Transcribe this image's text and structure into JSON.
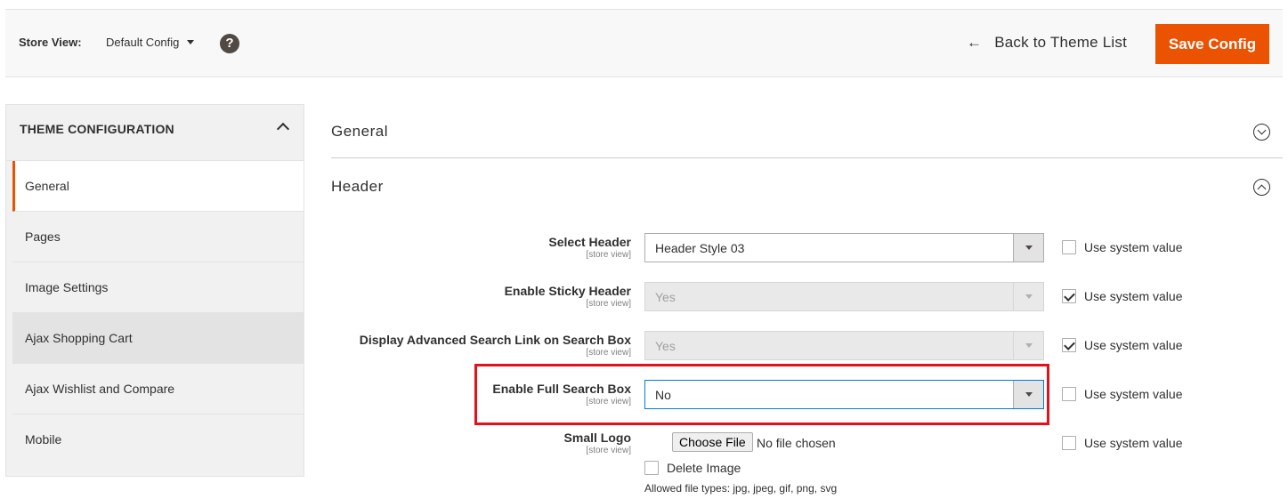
{
  "topbar": {
    "store_label": "Store View:",
    "store_value": "Default Config",
    "help_symbol": "?",
    "back_arrow": "←",
    "back_label": "Back to Theme List",
    "save_label": "Save Config",
    "accent_color": "#eb5202"
  },
  "sidebar": {
    "title": "THEME CONFIGURATION",
    "items": [
      {
        "label": "General",
        "state": "active"
      },
      {
        "label": "Pages",
        "state": "normal"
      },
      {
        "label": "Image Settings",
        "state": "normal"
      },
      {
        "label": "Ajax Shopping Cart",
        "state": "hover"
      },
      {
        "label": "Ajax Wishlist and Compare",
        "state": "normal"
      },
      {
        "label": "Mobile",
        "state": "normal"
      }
    ]
  },
  "sections": {
    "general": {
      "title": "General",
      "expanded": false
    },
    "header": {
      "title": "Header",
      "expanded": true
    }
  },
  "fields": {
    "select_header": {
      "label": "Select Header",
      "scope": "[store view]",
      "value": "Header Style 03",
      "disabled": false,
      "use_system": false
    },
    "sticky_header": {
      "label": "Enable Sticky Header",
      "scope": "[store view]",
      "value": "Yes",
      "disabled": true,
      "use_system": true
    },
    "adv_search_link": {
      "label": "Display Advanced Search Link on Search Box",
      "scope": "[store view]",
      "value": "Yes",
      "disabled": true,
      "use_system": true
    },
    "full_search_box": {
      "label": "Enable Full Search Box",
      "scope": "[store view]",
      "value": "No",
      "disabled": false,
      "use_system": false
    },
    "small_logo": {
      "label": "Small Logo",
      "scope": "[store view]",
      "choose_file": "Choose File",
      "no_file": "No file chosen",
      "delete_label": "Delete Image",
      "allowed": "Allowed file types: jpg, jpeg, gif, png, svg",
      "use_system": false
    },
    "use_system_label": "Use system value"
  },
  "highlight_color": "#e1121d"
}
